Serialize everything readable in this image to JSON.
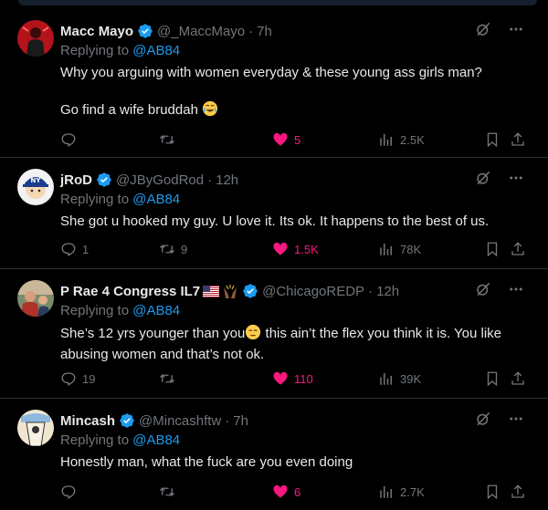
{
  "tweets": [
    {
      "name": "Macc Mayo",
      "handle": "@_MaccMayo",
      "time": "7h",
      "replying_label": "Replying to ",
      "replying_to": "@AB84",
      "text_line1": "Why you arguing with women everyday & these young ass girls man?",
      "text_line2": "Go find a wife bruddah",
      "replies": "",
      "retweets": "",
      "likes": "5",
      "views": "2.5K",
      "emoji": "tears-of-joy-emoji"
    },
    {
      "name": "jRoD",
      "handle": "@JByGodRod",
      "time": "12h",
      "replying_label": "Replying to ",
      "replying_to": "@AB84",
      "text_line1": "She got u hooked my guy. U love it. Its ok. It happens to the best of us.",
      "replies": "1",
      "retweets": "9",
      "likes": "1.5K",
      "views": "78K"
    },
    {
      "name": "P Rae 4 Congress IL7",
      "handle": "@ChicagoREDP",
      "time": "12h",
      "replying_label": "Replying to ",
      "replying_to": "@AB84",
      "text_line1a": "She’s 12 yrs younger than you",
      "text_line1b": " this ain’t the flex you think it is. You like",
      "text_line2": "abusing women and that’s not ok.",
      "replies": "19",
      "retweets": "",
      "likes": "110",
      "views": "39K",
      "emoji": "unamused-face-emoji"
    },
    {
      "name": "Mincash",
      "handle": "@Mincashftw",
      "time": "7h",
      "replying_label": "Replying to ",
      "replying_to": "@AB84",
      "text_line1": "Honestly man, what the fuck are you even doing",
      "replies": "",
      "retweets": "",
      "likes": "6",
      "views": "2.7K"
    }
  ],
  "colors": {
    "background": "#000000",
    "text": "#e7e9ea",
    "muted": "#71767b",
    "link": "#1d9bf0",
    "like": "#f91880",
    "divider": "#2f3336",
    "verified": "#1d9bf0"
  },
  "dot_separator": "·"
}
